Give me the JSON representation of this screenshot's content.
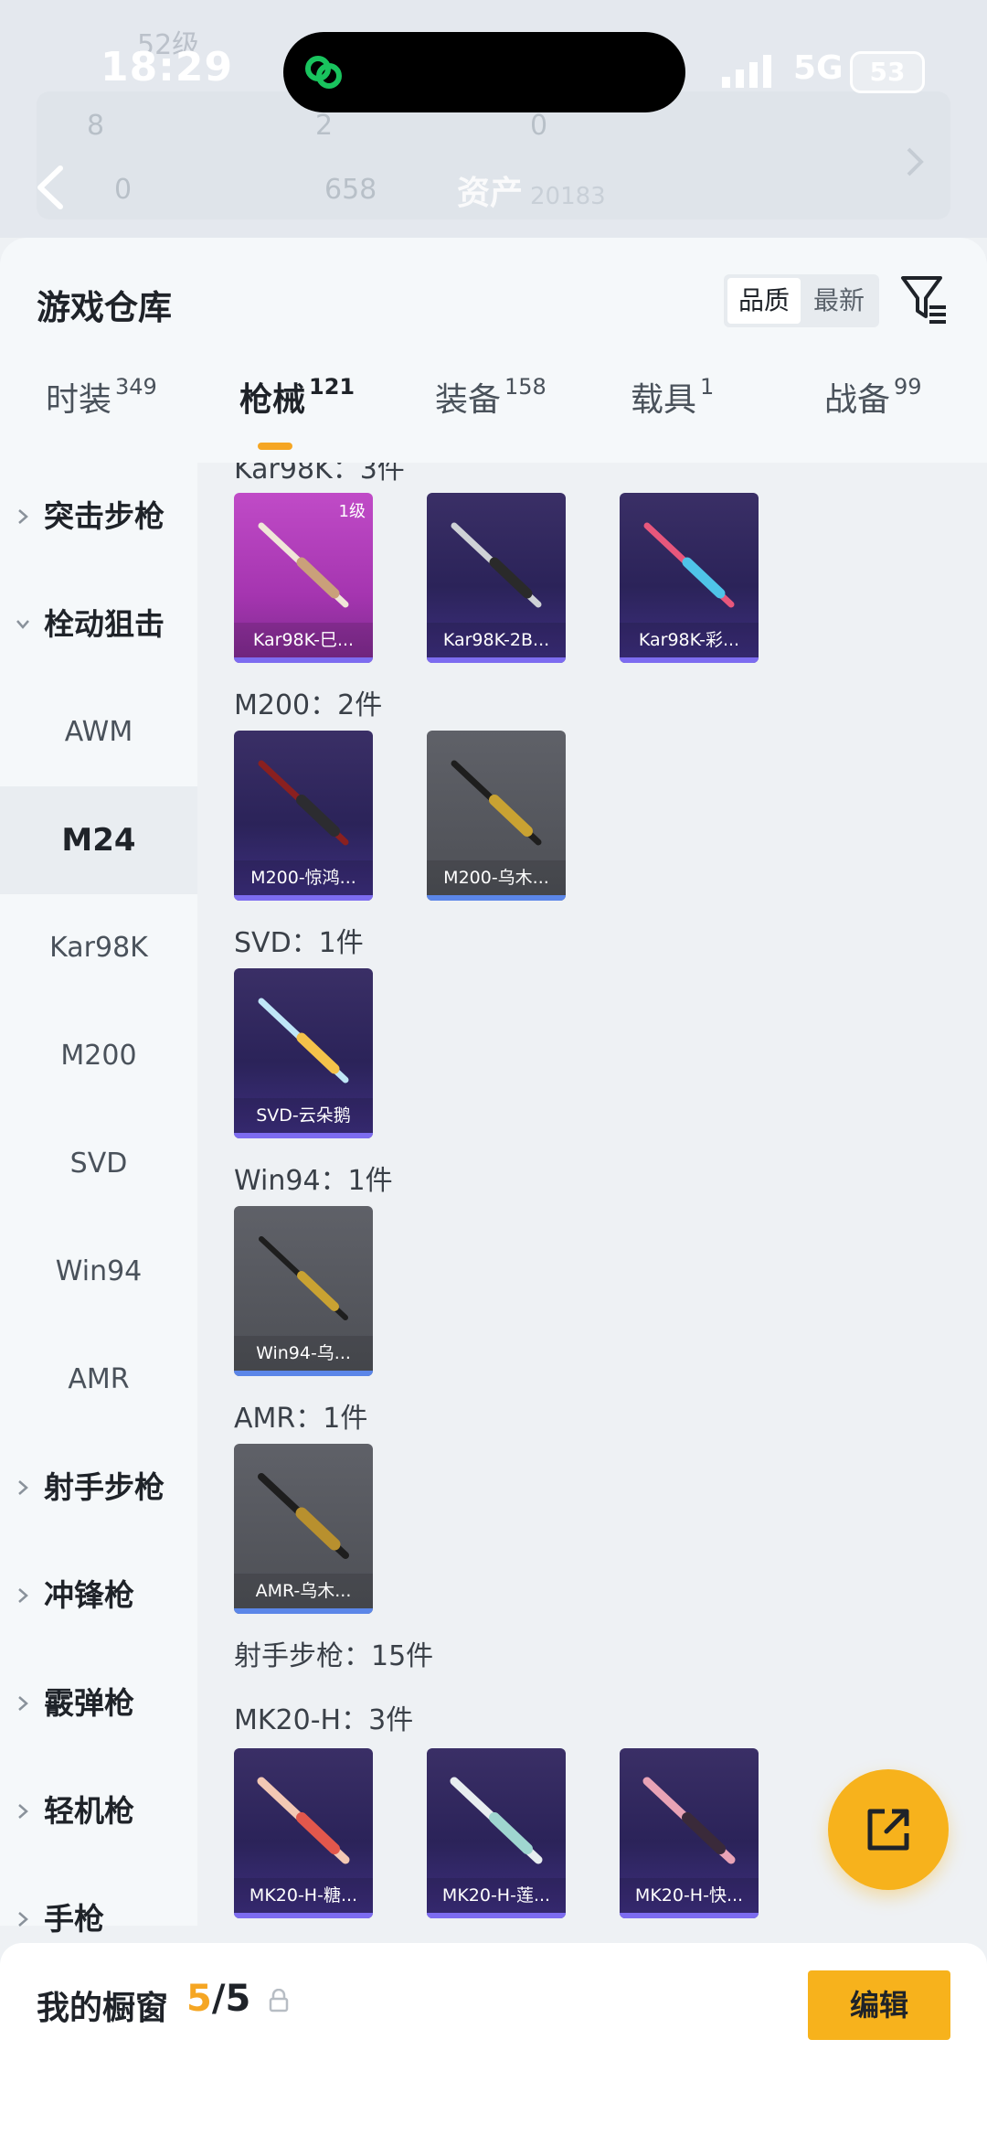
{
  "status": {
    "time": "18:29",
    "network": "5G",
    "battery": "53"
  },
  "header": {
    "assets_label": "资产",
    "assets_value": "20183"
  },
  "panel": {
    "title": "游戏仓库",
    "sort": {
      "quality": "品质",
      "newest": "最新"
    }
  },
  "tabs": [
    {
      "label": "时装",
      "count": "349"
    },
    {
      "label": "枪械",
      "count": "121"
    },
    {
      "label": "装备",
      "count": "158"
    },
    {
      "label": "载具",
      "count": "1"
    },
    {
      "label": "战备",
      "count": "99"
    }
  ],
  "sidebar": {
    "items": [
      {
        "label": "突击步枪"
      },
      {
        "label": "栓动狙击"
      },
      {
        "label": "AWM"
      },
      {
        "label": "M24"
      },
      {
        "label": "Kar98K"
      },
      {
        "label": "M200"
      },
      {
        "label": "SVD"
      },
      {
        "label": "Win94"
      },
      {
        "label": "AMR"
      },
      {
        "label": "射手步枪"
      },
      {
        "label": "冲锋枪"
      },
      {
        "label": "霰弹枪"
      },
      {
        "label": "轻机枪"
      },
      {
        "label": "手枪"
      }
    ]
  },
  "content": {
    "groups": [
      {
        "label": "Kar98K：3件",
        "items": [
          {
            "name": "Kar98K-巳...",
            "level": "1级",
            "tier": "pink"
          },
          {
            "name": "Kar98K-2B...",
            "tier": "purple"
          },
          {
            "name": "Kar98K-彩...",
            "tier": "purple"
          }
        ]
      },
      {
        "label": "M200：2件",
        "items": [
          {
            "name": "M200-惊鸿...",
            "tier": "purple"
          },
          {
            "name": "M200-乌木...",
            "tier": "gray"
          }
        ]
      },
      {
        "label": "SVD：1件",
        "items": [
          {
            "name": "SVD-云朵鹅",
            "tier": "purple"
          }
        ]
      },
      {
        "label": "Win94：1件",
        "items": [
          {
            "name": "Win94-乌...",
            "tier": "gray"
          }
        ]
      },
      {
        "label": "AMR：1件",
        "items": [
          {
            "name": "AMR-乌木...",
            "tier": "gray"
          }
        ]
      },
      {
        "label": "射手步枪：15件",
        "items": []
      },
      {
        "label": "MK20-H：3件",
        "items": [
          {
            "name": "MK20-H-糖...",
            "tier": "purple"
          },
          {
            "name": "MK20-H-莲...",
            "tier": "purple"
          },
          {
            "name": "MK20-H-快...",
            "tier": "purple"
          }
        ]
      }
    ]
  },
  "footer": {
    "title": "我的橱窗",
    "count_current": "5",
    "count_total": "/5",
    "edit_label": "编辑"
  },
  "colors": {
    "accent": "#f7b21c",
    "tab_indicator": "#f5a623",
    "card_purple": "#2b2359",
    "card_pink": "#a535b0",
    "card_gray": "#4d4f55"
  },
  "icons": [
    "green-link-icon",
    "signal-icon",
    "back-arrow-icon",
    "filter-icon",
    "chevron-right-icon",
    "chevron-down-icon",
    "share-icon",
    "lock-icon"
  ]
}
